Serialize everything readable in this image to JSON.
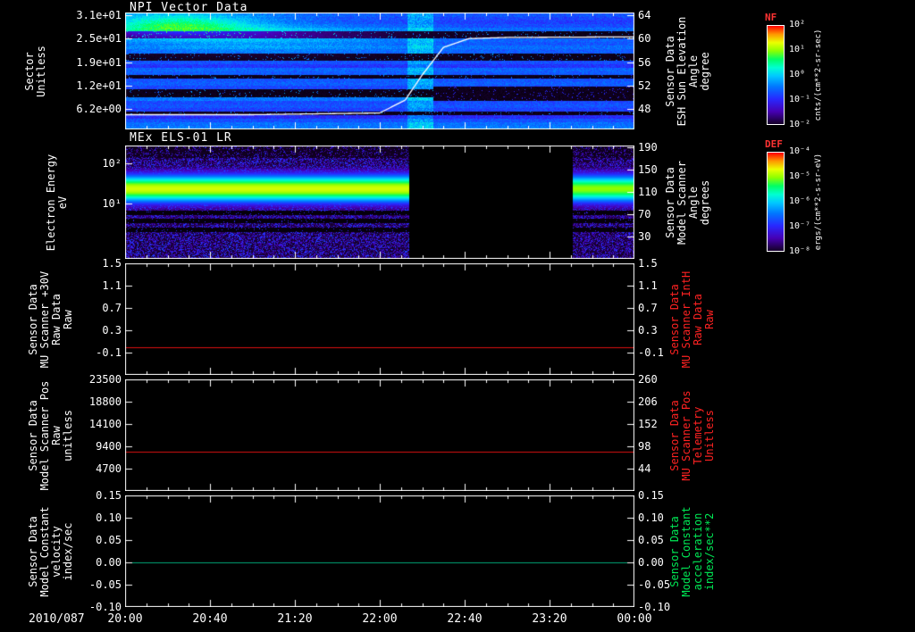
{
  "x_axis": {
    "date": "2010/087",
    "ticks": [
      "20:00",
      "20:40",
      "21:20",
      "22:00",
      "22:40",
      "23:20",
      "00:00"
    ],
    "start_hour": 20,
    "end_hour": 24
  },
  "chart_data": [
    {
      "type": "heatmap",
      "title": "NPI Vector Data",
      "ylabel_lines": [
        "Sector",
        "Unitless"
      ],
      "yticks": [
        "3.1e+01",
        "2.5e+01",
        "1.9e+01",
        "1.2e+01",
        "6.2e+00"
      ],
      "right_label_lines": [
        "Sensor Data",
        "ESH Sun Elevation",
        "Angle",
        "degree"
      ],
      "right_ticks": [
        "64",
        "60",
        "56",
        "52",
        "48"
      ],
      "right_label_color": "#ffffff",
      "colorbar": {
        "name": "NF",
        "units": "cnts/(cm**2-sr-sec)",
        "ticks": [
          "10²",
          "10¹",
          "10⁰",
          "10⁻¹",
          "10⁻²"
        ]
      },
      "content": "Blue sector-vs-time count spectrogram; bright cyan patch near top sectors before 21:00; disturbance column near 22:10; several dark sector rows; dark band around sectors 8-11 after 22:15",
      "overlay_curve": {
        "name": "ESH sun elevation angle",
        "color": "#ffffff",
        "x_hours": [
          20.0,
          21.0,
          22.0,
          22.2,
          22.33,
          22.5,
          22.7,
          23.0,
          24.0
        ],
        "y_degrees": [
          47.0,
          47.0,
          47.3,
          49.5,
          53.7,
          58.5,
          60.0,
          60.2,
          60.3
        ]
      }
    },
    {
      "type": "heatmap",
      "title": "MEx ELS-01 LR",
      "ylabel_lines": [
        "Electron Energy",
        "eV"
      ],
      "yscale": "log",
      "yticks": [
        "10²",
        "10¹"
      ],
      "right_label_lines": [
        "Sensor Data",
        "Model Scanner",
        "Angle",
        "degrees"
      ],
      "right_ticks": [
        "190",
        "150",
        "110",
        "70",
        "30"
      ],
      "right_label_color": "#ffffff",
      "colorbar": {
        "name": "DEF",
        "units": "ergs/(cm**2-s-sr-eV)",
        "ticks": [
          "10⁻⁴",
          "10⁻⁵",
          "10⁻⁶",
          "10⁻⁷",
          "10⁻⁸"
        ]
      },
      "content": "Electron energy-time spectrogram; bright green-yellow flux band ~5-40 eV; blue speckle background; thin black energy stripes below the band; telemetry data gap",
      "data_gap": {
        "start_hour": 22.23,
        "end_hour": 23.51
      }
    },
    {
      "type": "line",
      "ylabel_lines": [
        "Sensor Data",
        "MU Scanner +30V",
        "Raw Data",
        "Raw"
      ],
      "yticks": [
        "1.5",
        "1.1",
        "0.7",
        "0.3",
        "-0.1"
      ],
      "right_ticks": [
        "1.5",
        "1.1",
        "0.7",
        "0.3",
        "-0.1"
      ],
      "right_label_lines": [
        "Sensor Data",
        "MU Scanner IntH",
        "Raw Data",
        "Raw"
      ],
      "right_label_color": "#ff2222",
      "series": [
        {
          "name": "MU Scanner +30V Raw",
          "color": "#dd1111",
          "constant_value": 0.0
        }
      ]
    },
    {
      "type": "line",
      "ylabel_lines": [
        "Sensor Data",
        "Model Scanner Pos",
        "Raw",
        "unitless"
      ],
      "yticks": [
        "23500",
        "18800",
        "14100",
        "9400",
        "4700"
      ],
      "right_ticks": [
        "260",
        "206",
        "152",
        "98",
        "44"
      ],
      "right_label_lines": [
        "Sensor Data",
        "MU Scanner Pos",
        "Telemetry",
        "Unitless"
      ],
      "right_label_color": "#ff2222",
      "series": [
        {
          "name": "Model Scanner Pos Raw",
          "color": "#dd1111",
          "constant_value": 8200
        }
      ]
    },
    {
      "type": "line",
      "ylabel_lines": [
        "Sensor Data",
        "Model Constant",
        "velocity",
        "index/sec"
      ],
      "yticks": [
        "0.15",
        "0.10",
        "0.05",
        "0.00",
        "-0.05",
        "-0.10"
      ],
      "right_ticks": [
        "0.15",
        "0.10",
        "0.05",
        "0.00",
        "-0.05",
        "-0.10"
      ],
      "right_label_lines": [
        "Sensor Data",
        "Model Constant",
        "acceleration",
        "index/sec**2"
      ],
      "right_label_color": "#00e855",
      "series": [
        {
          "name": "Model Constant velocity",
          "color": "#00a878",
          "constant_value": 0.0
        }
      ]
    }
  ]
}
